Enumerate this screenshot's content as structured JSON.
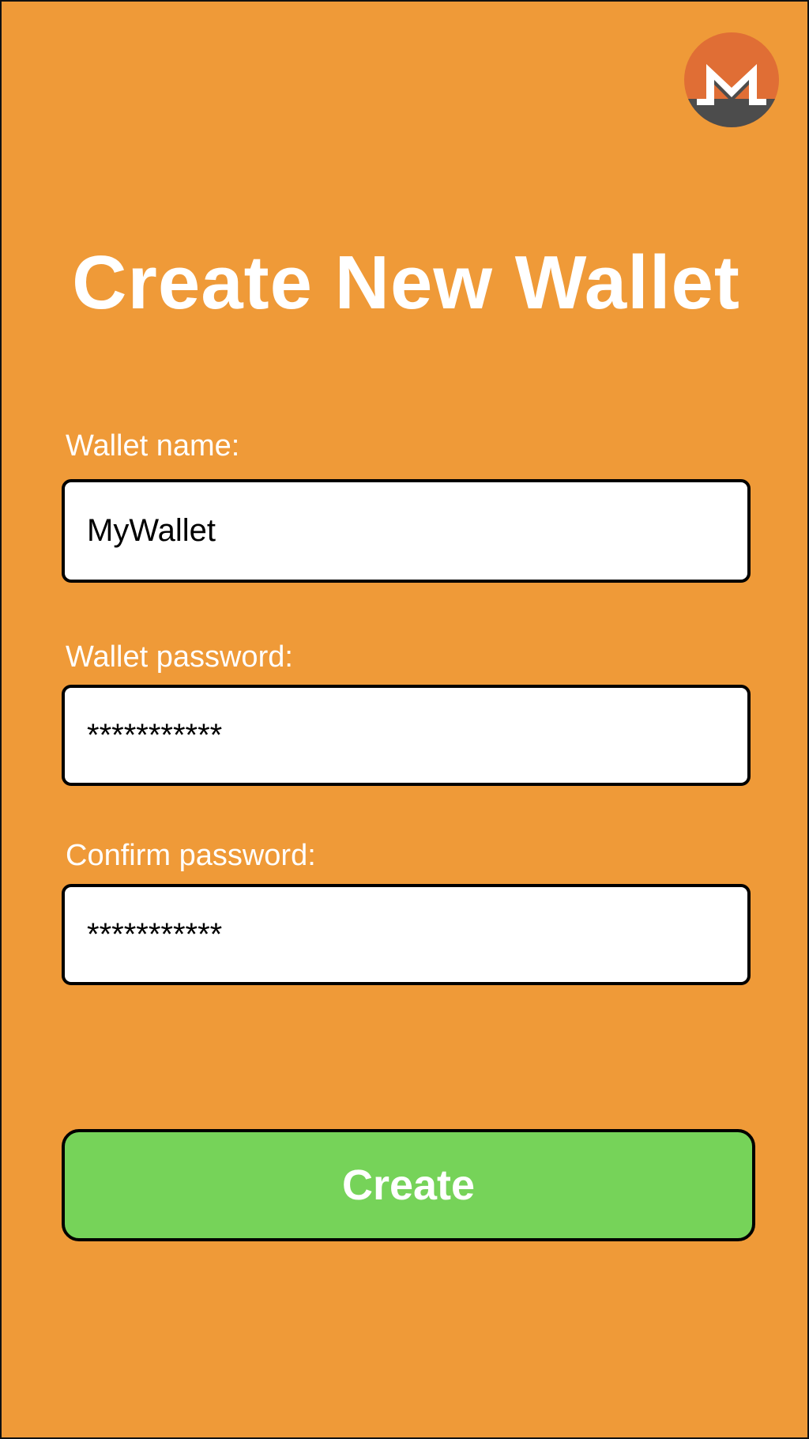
{
  "colors": {
    "background": "#EF9A38",
    "title_text": "#FFFFFF",
    "input_background": "#FFFFFF",
    "button_background": "#76D359",
    "logo_orange": "#E06E35",
    "logo_gray": "#4C4C4C"
  },
  "header": {
    "logo_icon": "monero-logo-icon"
  },
  "page": {
    "title": "Create New Wallet"
  },
  "form": {
    "wallet_name": {
      "label": "Wallet name:",
      "value": "MyWallet"
    },
    "wallet_password": {
      "label": "Wallet password:",
      "value": "***********"
    },
    "confirm_password": {
      "label": "Confirm password:",
      "value": "***********"
    },
    "submit_label": "Create"
  }
}
